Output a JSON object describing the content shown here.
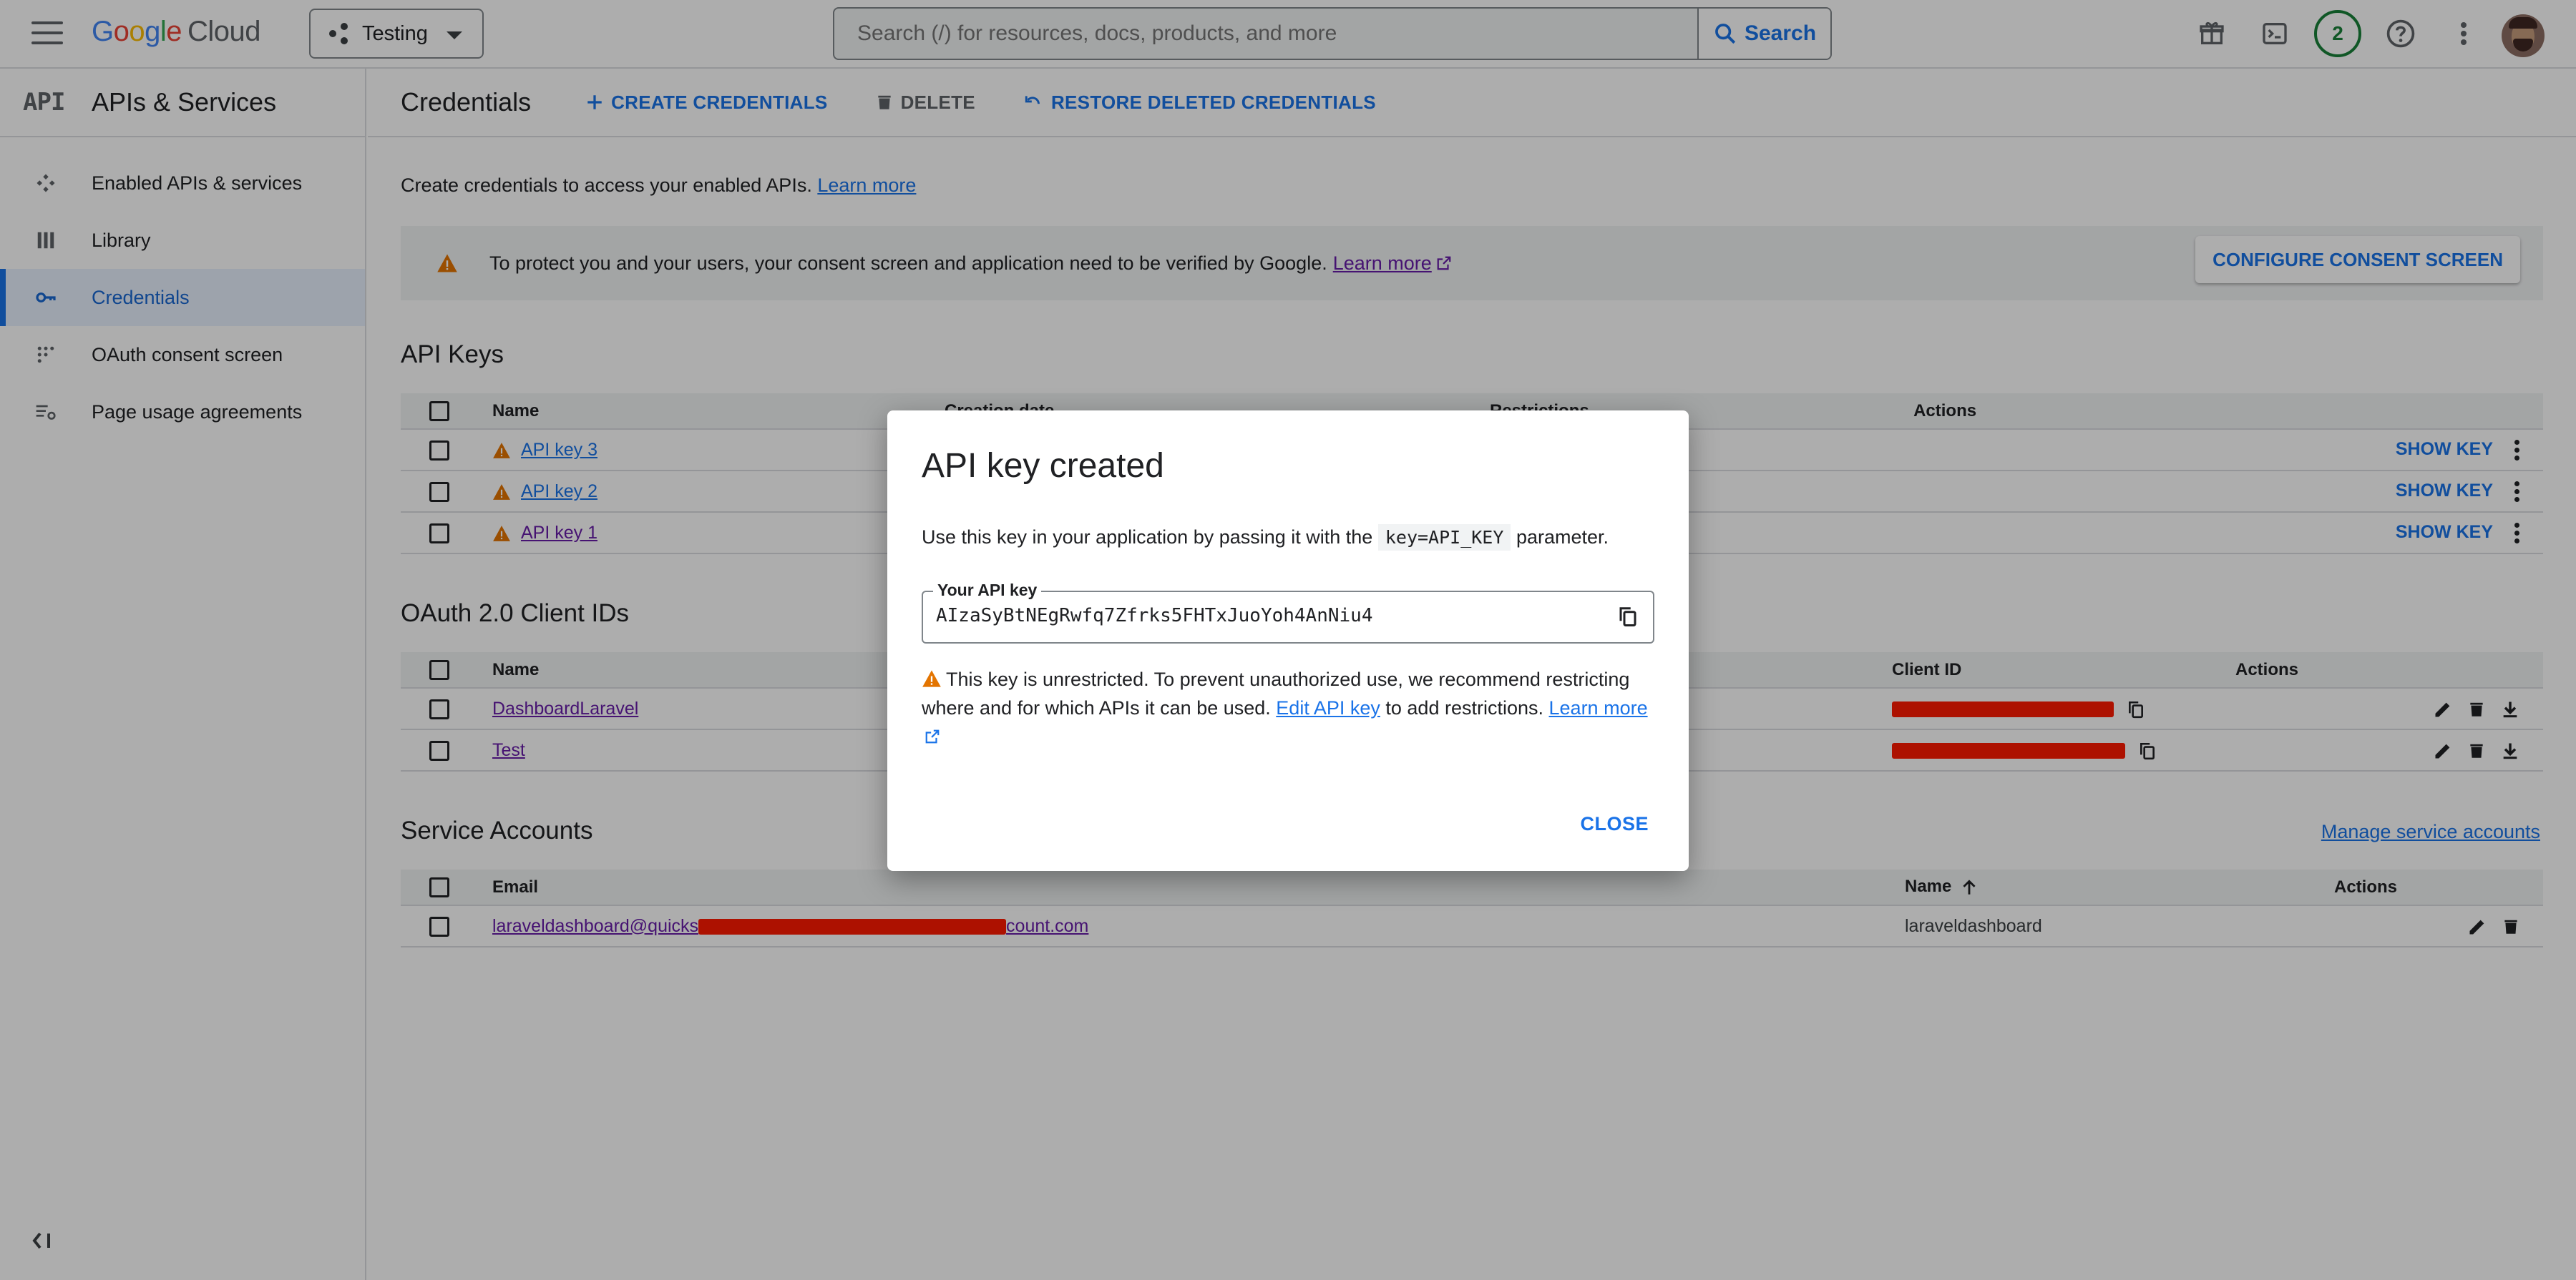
{
  "topbar": {
    "logo_google": "Google",
    "logo_cloud": "Cloud",
    "project": "Testing",
    "search_placeholder": "Search (/) for resources, docs, products, and more",
    "search_button": "Search",
    "notifications_count": "2"
  },
  "sidebar": {
    "header_badge": "API",
    "header_title": "APIs & Services",
    "items": [
      {
        "label": "Enabled APIs & services",
        "icon": "hub-icon"
      },
      {
        "label": "Library",
        "icon": "library-icon"
      },
      {
        "label": "Credentials",
        "icon": "key-icon",
        "active": true
      },
      {
        "label": "OAuth consent screen",
        "icon": "consent-icon"
      },
      {
        "label": "Page usage agreements",
        "icon": "settings-list-icon"
      }
    ]
  },
  "page": {
    "title": "Credentials",
    "actions": {
      "create": "CREATE CREDENTIALS",
      "delete": "DELETE",
      "restore": "RESTORE DELETED CREDENTIALS"
    },
    "intro": "Create credentials to access your enabled APIs.",
    "intro_link": "Learn more",
    "banner_text": "To protect you and your users, your consent screen and application need to be verified by Google.",
    "banner_link": "Learn more",
    "banner_button": "CONFIGURE CONSENT SCREEN"
  },
  "api_keys": {
    "title": "API Keys",
    "columns": {
      "name": "Name",
      "creation": "Creation date",
      "restrictions": "Restrictions",
      "actions": "Actions"
    },
    "rows": [
      {
        "name": "API key 3",
        "action": "SHOW KEY"
      },
      {
        "name": "API key 2",
        "action": "SHOW KEY"
      },
      {
        "name": "API key 1",
        "action": "SHOW KEY"
      }
    ]
  },
  "oauth": {
    "title": "OAuth 2.0 Client IDs",
    "columns": {
      "name": "Name",
      "client_id": "Client ID",
      "actions": "Actions"
    },
    "rows": [
      {
        "name": "DashboardLaravel"
      },
      {
        "name": "Test"
      }
    ]
  },
  "service_accounts": {
    "title": "Service Accounts",
    "manage_link": "Manage service accounts",
    "columns": {
      "email": "Email",
      "name": "Name",
      "actions": "Actions"
    },
    "rows": [
      {
        "email_start": "laraveldashboard@quicks",
        "email_end": "count.com",
        "name": "laraveldashboard"
      }
    ]
  },
  "dialog": {
    "title": "API key created",
    "desc_before": "Use this key in your application by passing it with the",
    "desc_code": "key=API_KEY",
    "desc_after": "parameter.",
    "field_label": "Your API key",
    "api_key": "AIzaSyBtNEgRwfq7Zfrks5FHTxJuoYoh4AnNiu4",
    "note_text": "This key is unrestricted. To prevent unauthorized use, we recommend restricting where and for which APIs it can be used.",
    "note_link": "Edit API key",
    "note_after": "to add restrictions.",
    "note_learn": "Learn more",
    "close": "CLOSE"
  },
  "colors": {
    "accent": "#1a73e8",
    "warning": "#e37400",
    "redaction": "#ff1a00",
    "link_visited": "#681da8"
  }
}
